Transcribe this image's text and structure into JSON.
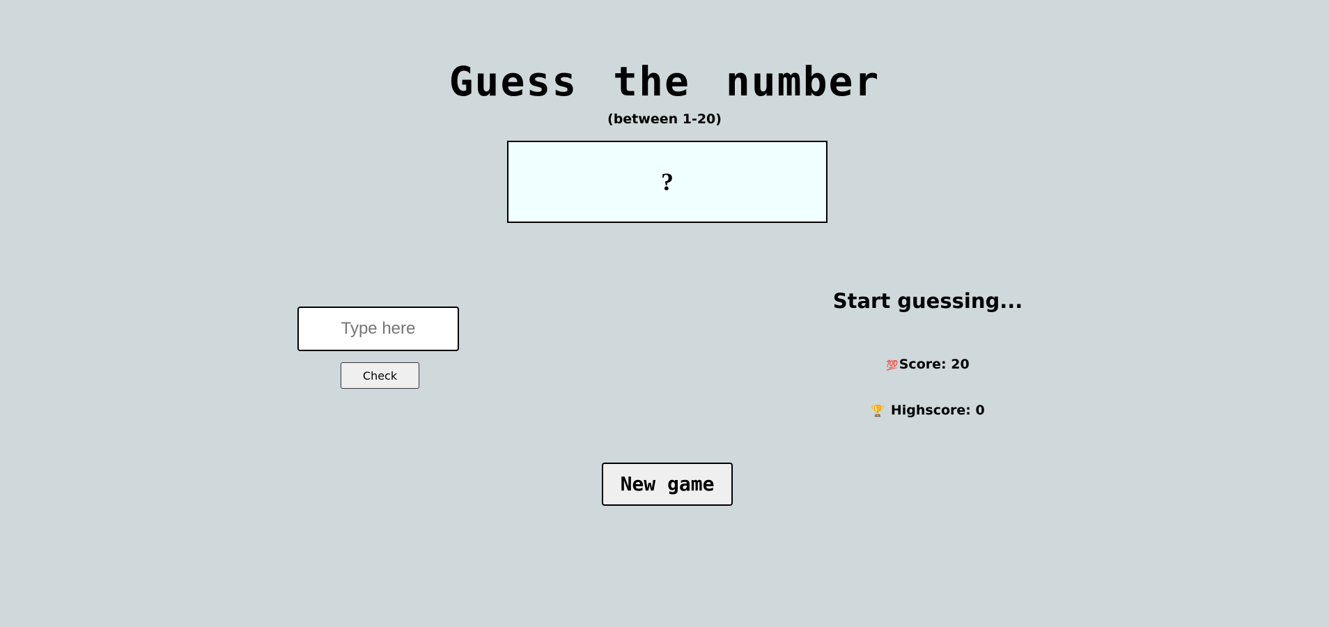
{
  "header": {
    "title": "Guess the number",
    "subtitle": "(between 1-20)"
  },
  "secret": {
    "value": "?"
  },
  "guess": {
    "placeholder": "Type here",
    "value": "",
    "check_label": "Check"
  },
  "status": {
    "message": "Start guessing...",
    "score_icon": "💯",
    "score_label": "Score: 20",
    "highscore_icon": "🏆",
    "highscore_label": "Highscore: 0"
  },
  "controls": {
    "new_game_label": "New game"
  },
  "colors": {
    "background": "#cfd8da",
    "secret_box": "#f0ffff",
    "button": "#efefef"
  }
}
